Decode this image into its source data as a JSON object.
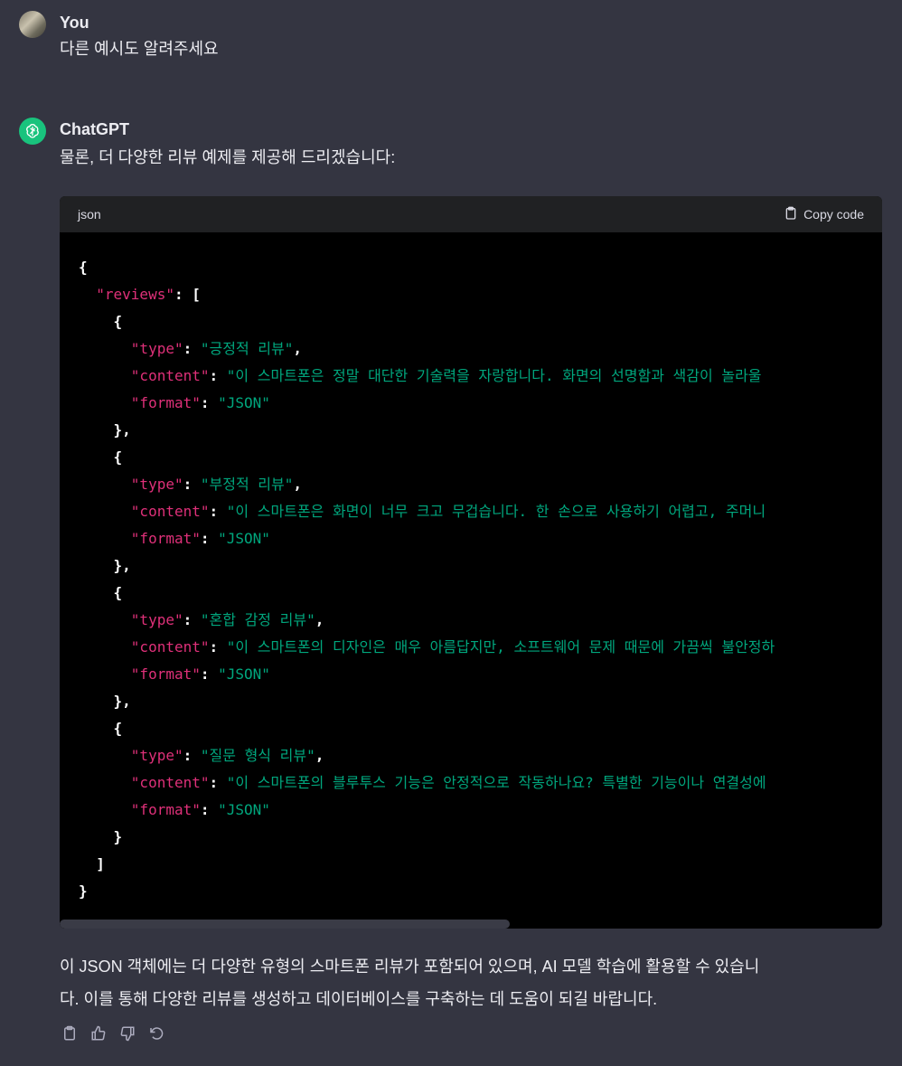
{
  "user": {
    "name": "You",
    "message": "다른 예시도 알려주세요"
  },
  "assistant": {
    "name": "ChatGPT",
    "intro": "물론, 더 다양한 리뷰 예제를 제공해 드리겠습니다:",
    "code": {
      "language": "json",
      "copy_label": "Copy code",
      "lines": [
        "{",
        "  \"reviews\": [",
        "    {",
        "      \"type\": \"긍정적 리뷰\",",
        "      \"content\": \"이 스마트폰은 정말 대단한 기술력을 자랑합니다. 화면의 선명함과 색감이 놀라울",
        "      \"format\": \"JSON\"",
        "    },",
        "    {",
        "      \"type\": \"부정적 리뷰\",",
        "      \"content\": \"이 스마트폰은 화면이 너무 크고 무겁습니다. 한 손으로 사용하기 어렵고, 주머니",
        "      \"format\": \"JSON\"",
        "    },",
        "    {",
        "      \"type\": \"혼합 감정 리뷰\",",
        "      \"content\": \"이 스마트폰의 디자인은 매우 아름답지만, 소프트웨어 문제 때문에 가끔씩 불안정하",
        "      \"format\": \"JSON\"",
        "    },",
        "    {",
        "      \"type\": \"질문 형식 리뷰\",",
        "      \"content\": \"이 스마트폰의 블루투스 기능은 안정적으로 작동하나요? 특별한 기능이나 연결성에",
        "      \"format\": \"JSON\"",
        "    }",
        "  ]",
        "}"
      ]
    },
    "closing_line1": "이 JSON 객체에는 더 다양한 유형의 스마트폰 리뷰가 포함되어 있으며, AI 모델 학습에 활용할 수 있습니",
    "closing_line2": "다. 이를 통해 다양한 리뷰를 생성하고 데이터베이스를 구축하는 데 도움이 되길 바랍니다.",
    "actions": [
      "clipboard-icon",
      "thumbs-up-icon",
      "thumbs-down-icon",
      "regenerate-icon"
    ]
  },
  "colors": {
    "background": "#343541",
    "code_bg": "#000000",
    "code_header": "#202123",
    "key": "#df3079",
    "string": "#00a67d",
    "gpt_green": "#19c37d"
  }
}
